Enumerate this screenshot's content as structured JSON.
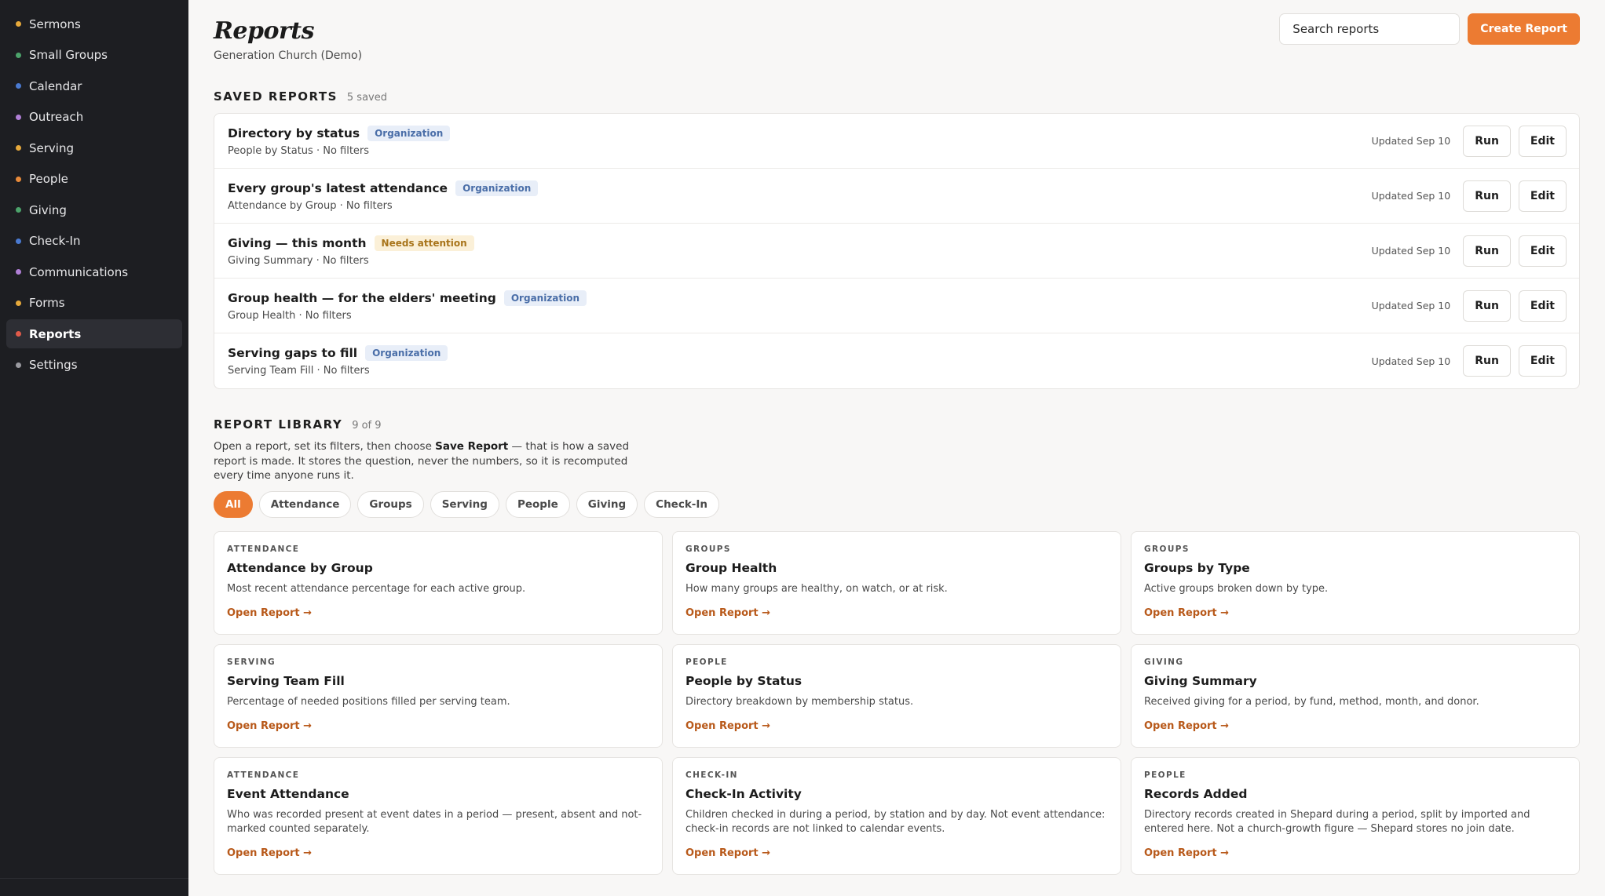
{
  "sidebar": {
    "items": [
      {
        "label": "Sermons",
        "color": "#e6a93b"
      },
      {
        "label": "Small Groups",
        "color": "#4ca36b"
      },
      {
        "label": "Calendar",
        "color": "#4a7ad1"
      },
      {
        "label": "Outreach",
        "color": "#b07fd6"
      },
      {
        "label": "Serving",
        "color": "#e6a93b"
      },
      {
        "label": "People",
        "color": "#e88a3a"
      },
      {
        "label": "Giving",
        "color": "#4ca36b"
      },
      {
        "label": "Check-In",
        "color": "#4a7ad1"
      },
      {
        "label": "Communications",
        "color": "#b07fd6"
      },
      {
        "label": "Forms",
        "color": "#e6a93b"
      },
      {
        "label": "Reports",
        "color": "#e05a4a",
        "active": true
      },
      {
        "label": "Settings",
        "color": "#9a9aa0"
      }
    ]
  },
  "header": {
    "title": "Reports",
    "subtitle": "Generation Church (Demo)",
    "search_placeholder": "Search reports",
    "create_label": "Create Report"
  },
  "saved": {
    "title": "SAVED REPORTS",
    "count": "5 saved",
    "run_label": "Run",
    "edit_label": "Edit",
    "rows": [
      {
        "name": "Directory by status",
        "badge": "Organization",
        "badge_type": "org",
        "meta": "People by Status · No filters",
        "updated": "Updated Sep 10"
      },
      {
        "name": "Every group's latest attendance",
        "badge": "Organization",
        "badge_type": "org",
        "meta": "Attendance by Group · No filters",
        "updated": "Updated Sep 10"
      },
      {
        "name": "Giving — this month",
        "badge": "Needs attention",
        "badge_type": "warn",
        "meta": "Giving Summary · No filters",
        "updated": "Updated Sep 10"
      },
      {
        "name": "Group health — for the elders' meeting",
        "badge": "Organization",
        "badge_type": "org",
        "meta": "Group Health · No filters",
        "updated": "Updated Sep 10"
      },
      {
        "name": "Serving gaps to fill",
        "badge": "Organization",
        "badge_type": "org",
        "meta": "Serving Team Fill · No filters",
        "updated": "Updated Sep 10"
      }
    ]
  },
  "library": {
    "title": "REPORT LIBRARY",
    "count": "9 of 9",
    "desc_before": "Open a report, set its filters, then choose ",
    "desc_bold": "Save Report",
    "desc_after": " — that is how a saved report is made. It stores the question, never the numbers, so it is recomputed every time anyone runs it.",
    "chips": [
      "All",
      "Attendance",
      "Groups",
      "Serving",
      "People",
      "Giving",
      "Check-In"
    ],
    "active_chip": "All",
    "open_label": "Open Report →",
    "cards": [
      {
        "category": "ATTENDANCE",
        "title": "Attendance by Group",
        "desc": "Most recent attendance percentage for each active group."
      },
      {
        "category": "GROUPS",
        "title": "Group Health",
        "desc": "How many groups are healthy, on watch, or at risk."
      },
      {
        "category": "GROUPS",
        "title": "Groups by Type",
        "desc": "Active groups broken down by type."
      },
      {
        "category": "SERVING",
        "title": "Serving Team Fill",
        "desc": "Percentage of needed positions filled per serving team."
      },
      {
        "category": "PEOPLE",
        "title": "People by Status",
        "desc": "Directory breakdown by membership status."
      },
      {
        "category": "GIVING",
        "title": "Giving Summary",
        "desc": "Received giving for a period, by fund, method, month, and donor."
      },
      {
        "category": "ATTENDANCE",
        "title": "Event Attendance",
        "desc": "Who was recorded present at event dates in a period — present, absent and not-marked counted separately."
      },
      {
        "category": "CHECK-IN",
        "title": "Check-In Activity",
        "desc": "Children checked in during a period, by station and by day. Not event attendance: check-in records are not linked to calendar events."
      },
      {
        "category": "PEOPLE",
        "title": "Records Added",
        "desc": "Directory records created in Shepard during a period, split by imported and entered here. Not a church-growth figure — Shepard stores no join date."
      }
    ]
  }
}
